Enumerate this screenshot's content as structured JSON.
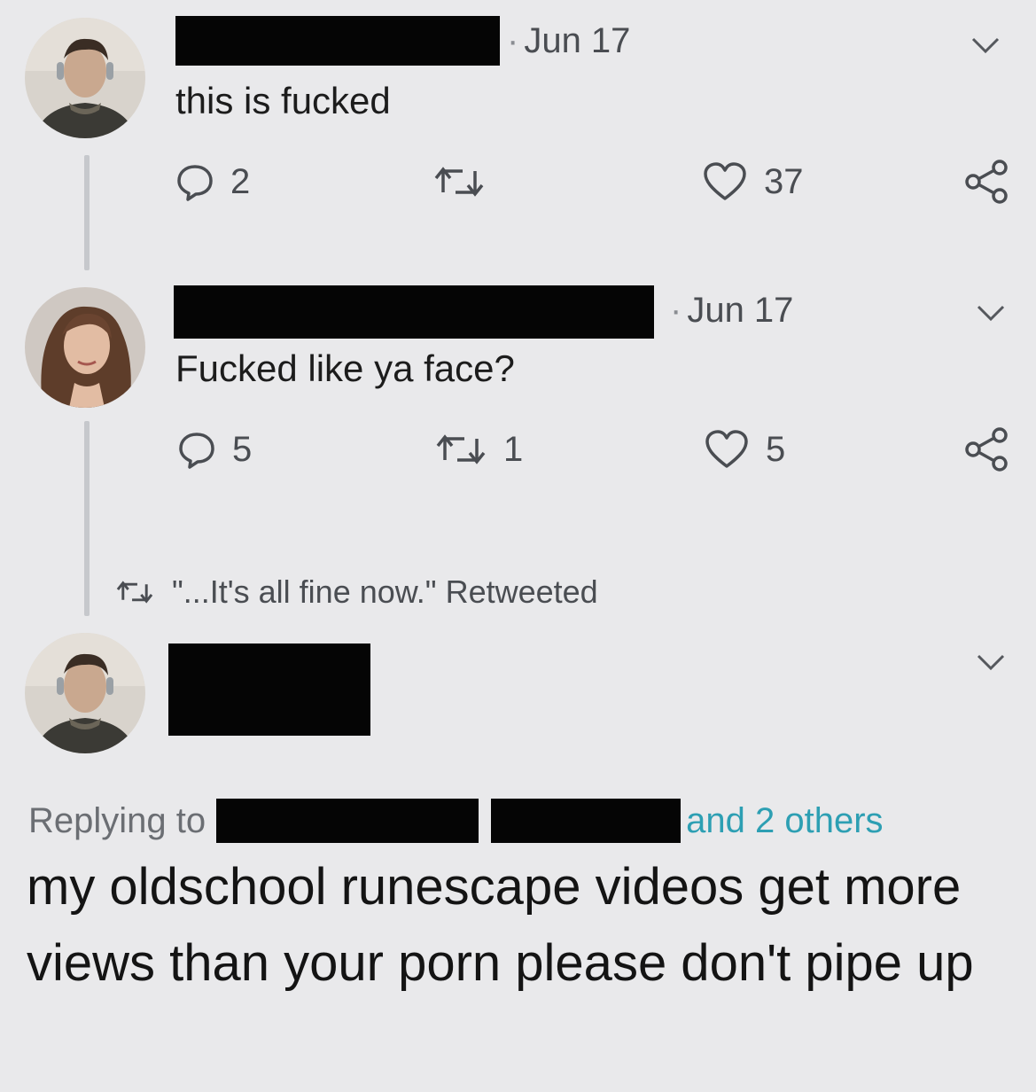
{
  "tweets": [
    {
      "date": "Jun 17",
      "text": "this is fucked",
      "actions": {
        "replies": "2",
        "retweets": "",
        "likes": "37"
      }
    },
    {
      "date": "Jun 17",
      "text": "Fucked like ya face?",
      "actions": {
        "replies": "5",
        "retweets": "1",
        "likes": "5"
      }
    }
  ],
  "retweet_notice": "\"...It's all fine now.\" Retweeted",
  "reply": {
    "replying_label": "Replying to",
    "others_label": "and 2 others",
    "text": "my oldschool runescape videos get more views than your porn please don't pipe up"
  },
  "icons": {
    "reply": "reply-icon",
    "retweet": "retweet-icon",
    "like": "heart-icon",
    "share": "share-icon",
    "menu": "chevron-down-icon"
  },
  "colors": {
    "background": "#e9e9eb",
    "text": "#1c1c1c",
    "muted": "#4a4d52",
    "link": "#2d9fb3",
    "redaction": "#050505"
  }
}
